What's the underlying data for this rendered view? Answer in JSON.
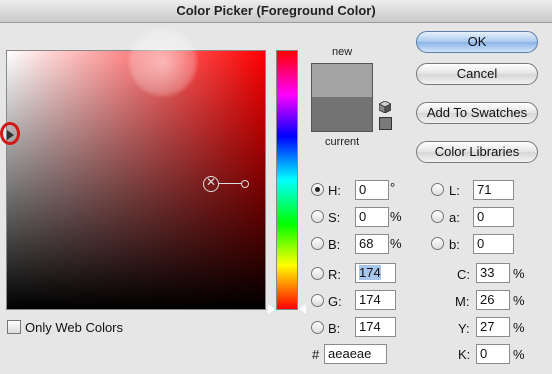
{
  "window": {
    "title": "Color Picker (Foreground Color)"
  },
  "swatches": {
    "new_label": "new",
    "current_label": "current",
    "new_color": "#a3a3a3",
    "current_color": "#737373"
  },
  "buttons": {
    "ok": "OK",
    "cancel": "Cancel",
    "add_to_swatches": "Add To Swatches",
    "color_libraries": "Color Libraries"
  },
  "hsb": {
    "h": {
      "label": "H:",
      "value": "0",
      "unit": "°",
      "checked": true
    },
    "s": {
      "label": "S:",
      "value": "0",
      "unit": "%"
    },
    "b": {
      "label": "B:",
      "value": "68",
      "unit": "%"
    }
  },
  "rgb": {
    "r": {
      "label": "R:",
      "value": "174"
    },
    "g": {
      "label": "G:",
      "value": "174"
    },
    "b": {
      "label": "B:",
      "value": "174"
    }
  },
  "lab": {
    "l": {
      "label": "L:",
      "value": "71"
    },
    "a": {
      "label": "a:",
      "value": "0"
    },
    "b": {
      "label": "b:",
      "value": "0"
    }
  },
  "cmyk": {
    "c": {
      "label": "C:",
      "value": "33",
      "unit": "%"
    },
    "m": {
      "label": "M:",
      "value": "26",
      "unit": "%"
    },
    "y": {
      "label": "Y:",
      "value": "27",
      "unit": "%"
    },
    "k": {
      "label": "K:",
      "value": "0",
      "unit": "%"
    }
  },
  "hex": {
    "label": "#",
    "value": "aeaeae"
  },
  "web_colors": {
    "label": "Only Web Colors",
    "checked": false
  },
  "colors": {
    "highlight_ring": "#d31616",
    "field_hue": "#ff0000"
  }
}
